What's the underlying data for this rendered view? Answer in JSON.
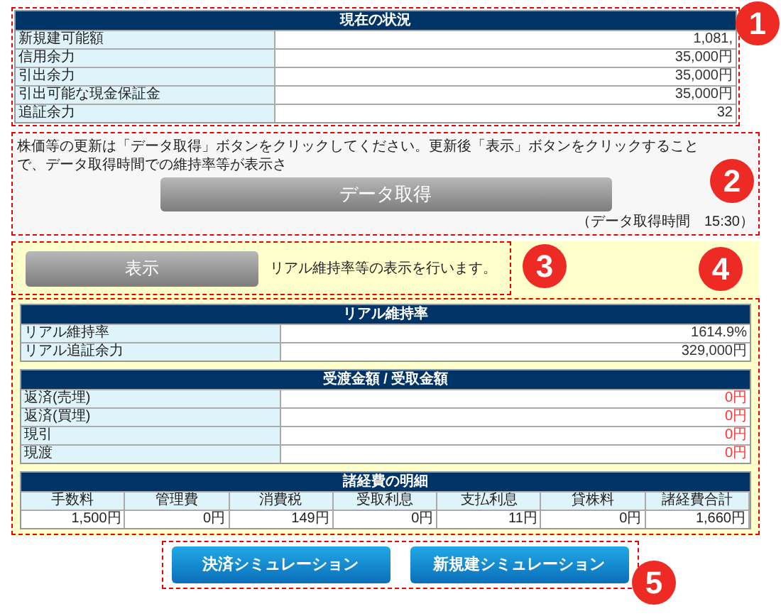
{
  "status": {
    "title": "現在の状況",
    "rows": [
      {
        "label": "新規建可能額",
        "value": "1,081,"
      },
      {
        "label": "信用余力",
        "value": "35,000円"
      },
      {
        "label": "引出余力",
        "value": "35,000円"
      },
      {
        "label": "引出可能な現金保証金",
        "value": "35,000円"
      },
      {
        "label": "追証余力",
        "value": "32"
      }
    ]
  },
  "update": {
    "note": "株価等の更新は「データ取得」ボタンをクリックしてください。更新後「表示」ボタンをクリックすることで、データ取得時間での維持率等が表示さ",
    "button": "データ取得",
    "time": "（データ取得時間　15:30）"
  },
  "display": {
    "button": "表示",
    "note": "リアル維持率等の表示を行います。"
  },
  "real": {
    "title": "リアル維持率",
    "rows": [
      {
        "label": "リアル維持率",
        "value": "1614.9%"
      },
      {
        "label": "リアル追証余力",
        "value": "329,000円"
      }
    ]
  },
  "transfer": {
    "title": "受渡金額 / 受取金額",
    "rows": [
      {
        "label": "返済(売埋)",
        "value": "0円"
      },
      {
        "label": "返済(買埋)",
        "value": "0円"
      },
      {
        "label": "現引",
        "value": "0円"
      },
      {
        "label": "現渡",
        "value": "0円"
      }
    ]
  },
  "fees": {
    "title": "諸経費の明細",
    "columns": [
      "手数料",
      "管理費",
      "消費税",
      "受取利息",
      "支払利息",
      "貸株料",
      "諸経費合計"
    ],
    "values": [
      "1,500円",
      "0円",
      "149円",
      "0円",
      "11円",
      "0円",
      "1,660円"
    ]
  },
  "buttons": [
    "決済シミュレーション",
    "新規建シミュレーション"
  ],
  "callouts": [
    "1",
    "2",
    "3",
    "4",
    "5"
  ]
}
